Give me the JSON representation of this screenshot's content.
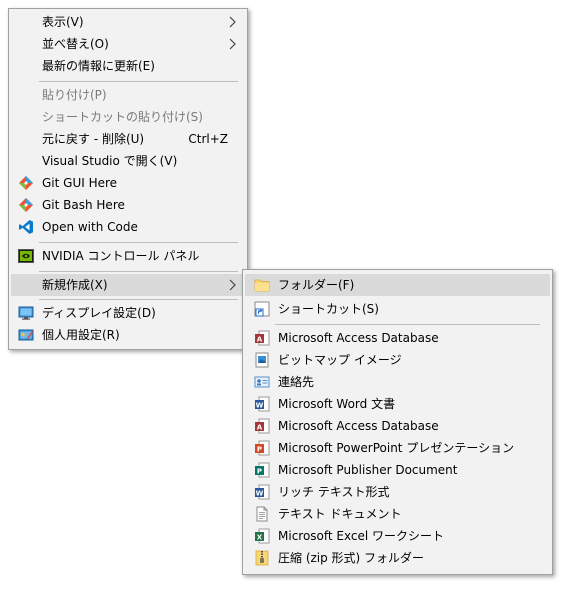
{
  "main_menu": {
    "items": [
      {
        "label": "表示(V)"
      },
      {
        "label": "並べ替え(O)"
      },
      {
        "label": "最新の情報に更新(E)"
      },
      {
        "label": "貼り付け(P)"
      },
      {
        "label": "ショートカットの貼り付け(S)"
      },
      {
        "label": "元に戻す - 削除(U)",
        "shortcut": "Ctrl+Z"
      },
      {
        "label": "Visual Studio で開く(V)"
      },
      {
        "label": "Git GUI Here",
        "icon": "git-icon"
      },
      {
        "label": "Git Bash Here",
        "icon": "git-icon"
      },
      {
        "label": "Open with Code",
        "icon": "vscode-icon"
      },
      {
        "label": "NVIDIA コントロール パネル",
        "icon": "nvidia-icon"
      },
      {
        "label": "新規作成(X)"
      },
      {
        "label": "ディスプレイ設定(D)",
        "icon": "display-icon"
      },
      {
        "label": "個人用設定(R)",
        "icon": "personalize-icon"
      }
    ]
  },
  "sub_menu": {
    "items": [
      {
        "label": "フォルダー(F)",
        "icon": "folder-icon"
      },
      {
        "label": "ショートカット(S)",
        "icon": "shortcut-icon"
      },
      {
        "label": "Microsoft Access Database",
        "icon": "access-icon"
      },
      {
        "label": "ビットマップ イメージ",
        "icon": "bitmap-icon"
      },
      {
        "label": "連絡先",
        "icon": "contact-icon"
      },
      {
        "label": "Microsoft Word 文書",
        "icon": "word-icon"
      },
      {
        "label": "Microsoft Access Database",
        "icon": "access-icon"
      },
      {
        "label": "Microsoft PowerPoint プレゼンテーション",
        "icon": "powerpoint-icon"
      },
      {
        "label": "Microsoft Publisher Document",
        "icon": "publisher-icon"
      },
      {
        "label": "リッチ テキスト形式",
        "icon": "rtf-icon"
      },
      {
        "label": "テキスト ドキュメント",
        "icon": "text-document-icon"
      },
      {
        "label": "Microsoft Excel ワークシート",
        "icon": "excel-icon"
      },
      {
        "label": "圧縮 (zip 形式) フォルダー",
        "icon": "zip-folder-icon"
      }
    ]
  },
  "colors": {
    "menu_bg": "#f2f2f2",
    "highlight": "#dadada",
    "disabled_text": "#7a7a7a",
    "separator": "#bdbdbd"
  }
}
